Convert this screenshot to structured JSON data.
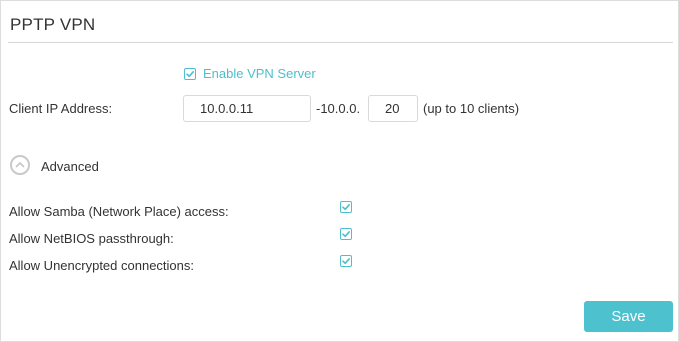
{
  "panel": {
    "title": "PPTP VPN"
  },
  "enable": {
    "label": "Enable VPN Server",
    "checked": true
  },
  "client_ip": {
    "label": "Client IP Address:",
    "start_value": "10.0.0.11",
    "separator": "-10.0.0.",
    "end_value": "20",
    "hint": "(up to 10 clients)"
  },
  "advanced": {
    "label": "Advanced",
    "icon": "chevron-up-circle-icon"
  },
  "options": [
    {
      "label": "Allow Samba (Network Place) access:",
      "checked": true
    },
    {
      "label": "Allow NetBIOS passthrough:",
      "checked": true
    },
    {
      "label": "Allow Unencrypted connections:",
      "checked": true
    }
  ],
  "actions": {
    "save_label": "Save"
  },
  "colors": {
    "accent": "#4dbfcd",
    "button": "#4ec1cf",
    "border": "#d9d9d9"
  }
}
